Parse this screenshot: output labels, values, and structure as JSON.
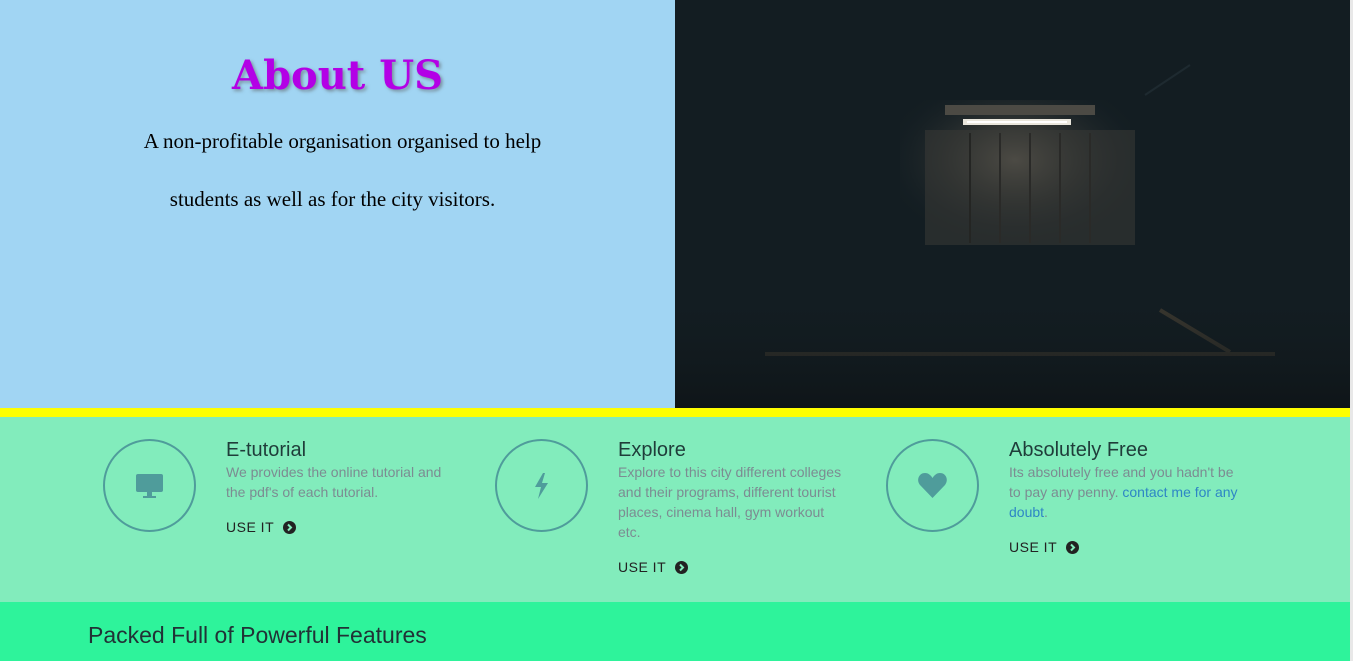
{
  "about": {
    "title": "About US",
    "line1": "A non-profitable organisation organised to help",
    "line2": "students as well as for the city visitors."
  },
  "features": [
    {
      "icon": "monitor-icon",
      "title": "E-tutorial",
      "desc": "We provides the online tutorial and the pdf's of each tutorial.",
      "link": "",
      "desc_end": "",
      "cta": "USE IT"
    },
    {
      "icon": "lightning-icon",
      "title": "Explore",
      "desc": "Explore to this city different colleges and their programs, different tourist places, cinema hall, gym workout etc.",
      "link": "",
      "desc_end": "",
      "cta": "USE IT"
    },
    {
      "icon": "heart-icon",
      "title": "Absolutely Free",
      "desc": "Its absolutely free and you hadn't be to pay any penny. ",
      "link": "contact me for any doubt",
      "desc_end": ".",
      "cta": "USE IT"
    }
  ],
  "bottom": {
    "heading": "Packed Full of Powerful Features"
  },
  "colors": {
    "about_bg": "#a1d5f3",
    "title": "#b300e6",
    "stripe": "#ffff00",
    "features_bg": "#82ecbc",
    "bottom_bg": "#2ef39b",
    "icon": "#4f9c9b",
    "link": "#2e86c5"
  }
}
